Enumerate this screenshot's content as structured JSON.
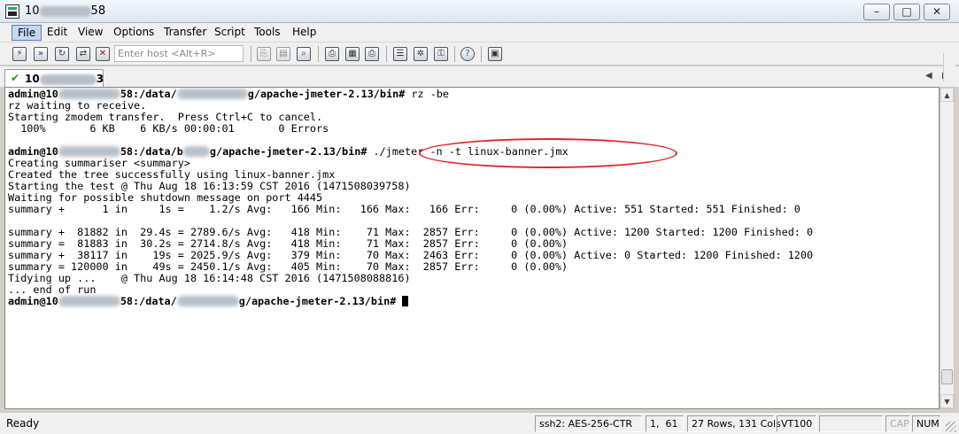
{
  "window": {
    "title_prefix": "10",
    "title_suffix": "58",
    "minimize": "–",
    "maximize": "□",
    "close": "✕"
  },
  "menu": [
    "File",
    "Edit",
    "View",
    "Options",
    "Transfer",
    "Script",
    "Tools",
    "Help"
  ],
  "toolbar": {
    "host_placeholder": "Enter host <Alt+R>",
    "icons": [
      "connect-icon",
      "quick-connect-icon",
      "reconnect-icon",
      "disconnect-icon",
      "copy-icon",
      "paste-icon",
      "find-icon",
      "print-setup-icon",
      "print-icon",
      "log-icon",
      "session-options-icon",
      "global-options-icon",
      "keymap-icon",
      "help-icon",
      "sftp-icon"
    ]
  },
  "tab": {
    "label_prefix": "10",
    "label_suffix": "3"
  },
  "terminal": {
    "lines": {
      "l1_a": "admin@10",
      "l1_b": "58:/data/",
      "l1_c": "g/apache-jmeter-2.13/bin#",
      "l1_cmd": " rz -be",
      "l2": "rz waiting to receive.",
      "l3": "Starting zmodem transfer.  Press Ctrl+C to cancel.",
      "l4": "  100%       6 KB    6 KB/s 00:00:01       0 Errors",
      "l6_a": "admin@10",
      "l6_b": "58:/data/b",
      "l6_c": "g/apache-jmeter-2.13/bin#",
      "l6_cmd": " ./jmeter -n -t linux-banner.jmx",
      "l7": "Creating summariser <summary>",
      "l8": "Created the tree successfully using linux-banner.jmx",
      "l9": "Starting the test @ Thu Aug 18 16:13:59 CST 2016 (1471508039758)",
      "l10": "Waiting for possible shutdown message on port 4445",
      "l11": "summary +      1 in     1s =    1.2/s Avg:   166 Min:   166 Max:   166 Err:     0 (0.00%) Active: 551 Started: 551 Finished: 0",
      "l13": "summary +  81882 in  29.4s = 2789.6/s Avg:   418 Min:    71 Max:  2857 Err:     0 (0.00%) Active: 1200 Started: 1200 Finished: 0",
      "l14": "summary =  81883 in  30.2s = 2714.8/s Avg:   418 Min:    71 Max:  2857 Err:     0 (0.00%)",
      "l15": "summary +  38117 in    19s = 2025.9/s Avg:   379 Min:    70 Max:  2463 Err:     0 (0.00%) Active: 0 Started: 1200 Finished: 1200",
      "l16": "summary = 120000 in    49s = 2450.1/s Avg:   405 Min:    70 Max:  2857 Err:     0 (0.00%)",
      "l17": "Tidying up ...    @ Thu Aug 18 16:14:48 CST 2016 (1471508088816)",
      "l18": "... end of run",
      "l19_a": "admin@10",
      "l19_b": "58:/data/",
      "l19_c": "g/apache-jmeter-2.13/bin#"
    },
    "highlight_color": "#e0262b"
  },
  "status": {
    "ready": "Ready",
    "cipher": "ssh2: AES-256-CTR",
    "cursor_pos": "1,  61",
    "size": "27 Rows, 131 Cols",
    "terminal_type": "VT100",
    "cap": "CAP",
    "num": "NUM"
  }
}
